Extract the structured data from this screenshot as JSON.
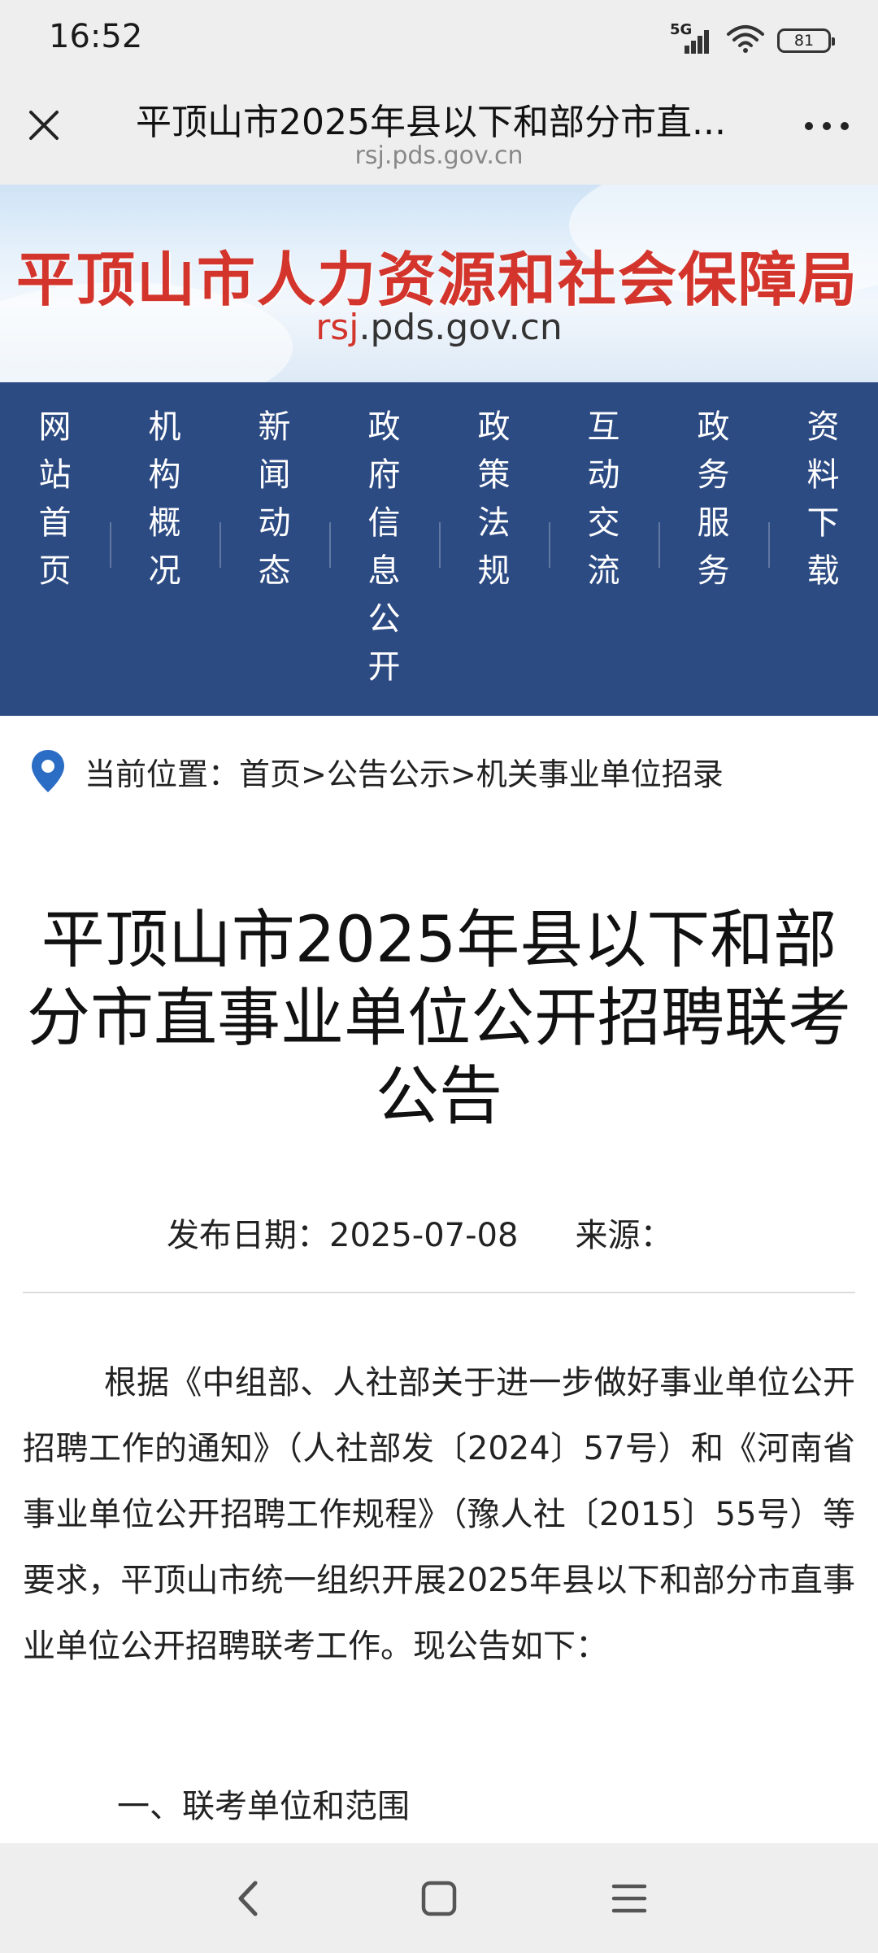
{
  "status_bar": {
    "time": "16:52",
    "network": "5G",
    "battery": "81"
  },
  "browser": {
    "title": "平顶山市2025年县以下和部分市直...",
    "url": "rsj.pds.gov.cn"
  },
  "banner": {
    "title": "平顶山市人力资源和社会保障局",
    "url_prefix": "rsj",
    "url_rest": ".pds.gov.cn"
  },
  "nav": {
    "items": [
      {
        "label": "网站首页"
      },
      {
        "label": "机构概况"
      },
      {
        "label": "新闻动态"
      },
      {
        "label": "政府信息公开"
      },
      {
        "label": "政策法规"
      },
      {
        "label": "互动交流"
      },
      {
        "label": "政务服务"
      },
      {
        "label": "资料下载"
      }
    ]
  },
  "breadcrumb": {
    "label": "当前位置：",
    "path": "首页>公告公示>机关事业单位招录"
  },
  "article": {
    "title": "平顶山市2025年县以下和部分市直事业单位公开招聘联考公告",
    "date_label": "发布日期：2025-07-08",
    "source_label": "来源：",
    "paragraph": "根据《中组部、人社部关于进一步做好事业单位公开招聘工作的通知》（人社部发〔2024〕57号）和《河南省事业单位公开招聘工作规程》（豫人社〔2015〕55号）等要求，平顶山市统一组织开展2025年县以下和部分市直事业单位公开招聘联考工作。现公告如下：",
    "section_1": "一、联考单位和范围"
  },
  "colors": {
    "nav_bg": "#2d4b83",
    "banner_title": "#d3342b",
    "location_pin": "#2b6cc4"
  },
  "icons": {
    "close": "close-icon",
    "more": "more-dots-icon",
    "location": "location-pin-icon",
    "back": "back-icon",
    "home": "home-square-icon",
    "menu": "menu-lines-icon"
  }
}
